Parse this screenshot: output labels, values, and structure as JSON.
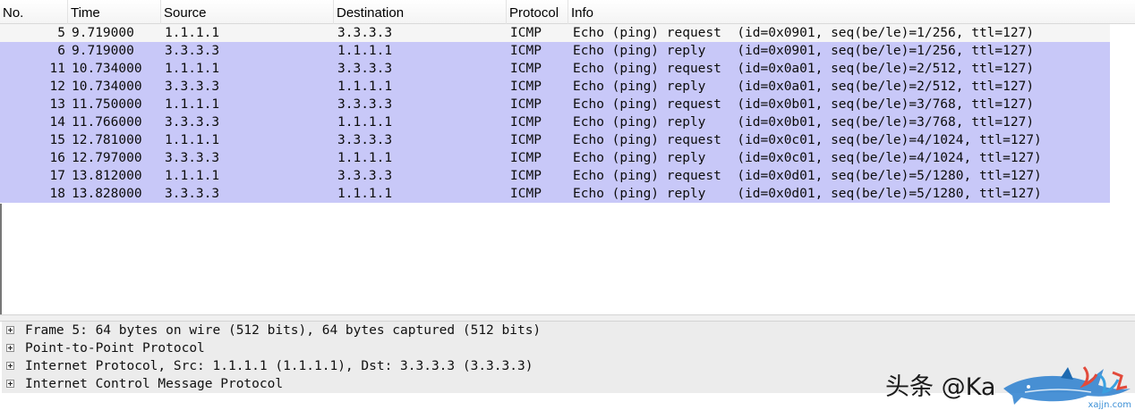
{
  "columns": {
    "no": "No.",
    "time": "Time",
    "source": "Source",
    "destination": "Destination",
    "protocol": "Protocol",
    "info": "Info"
  },
  "packets": [
    {
      "no": "5",
      "time": "9.719000",
      "source": "1.1.1.1",
      "destination": "3.3.3.3",
      "protocol": "ICMP",
      "info": "Echo (ping) request  (id=0x0901, seq(be/le)=1/256, ttl=127)",
      "selected": true
    },
    {
      "no": "6",
      "time": "9.719000",
      "source": "3.3.3.3",
      "destination": "1.1.1.1",
      "protocol": "ICMP",
      "info": "Echo (ping) reply    (id=0x0901, seq(be/le)=1/256, ttl=127)"
    },
    {
      "no": "11",
      "time": "10.734000",
      "source": "1.1.1.1",
      "destination": "3.3.3.3",
      "protocol": "ICMP",
      "info": "Echo (ping) request  (id=0x0a01, seq(be/le)=2/512, ttl=127)"
    },
    {
      "no": "12",
      "time": "10.734000",
      "source": "3.3.3.3",
      "destination": "1.1.1.1",
      "protocol": "ICMP",
      "info": "Echo (ping) reply    (id=0x0a01, seq(be/le)=2/512, ttl=127)"
    },
    {
      "no": "13",
      "time": "11.750000",
      "source": "1.1.1.1",
      "destination": "3.3.3.3",
      "protocol": "ICMP",
      "info": "Echo (ping) request  (id=0x0b01, seq(be/le)=3/768, ttl=127)"
    },
    {
      "no": "14",
      "time": "11.766000",
      "source": "3.3.3.3",
      "destination": "1.1.1.1",
      "protocol": "ICMP",
      "info": "Echo (ping) reply    (id=0x0b01, seq(be/le)=3/768, ttl=127)"
    },
    {
      "no": "15",
      "time": "12.781000",
      "source": "1.1.1.1",
      "destination": "3.3.3.3",
      "protocol": "ICMP",
      "info": "Echo (ping) request  (id=0x0c01, seq(be/le)=4/1024, ttl=127)"
    },
    {
      "no": "16",
      "time": "12.797000",
      "source": "3.3.3.3",
      "destination": "1.1.1.1",
      "protocol": "ICMP",
      "info": "Echo (ping) reply    (id=0x0c01, seq(be/le)=4/1024, ttl=127)"
    },
    {
      "no": "17",
      "time": "13.812000",
      "source": "1.1.1.1",
      "destination": "3.3.3.3",
      "protocol": "ICMP",
      "info": "Echo (ping) request  (id=0x0d01, seq(be/le)=5/1280, ttl=127)"
    },
    {
      "no": "18",
      "time": "13.828000",
      "source": "3.3.3.3",
      "destination": "1.1.1.1",
      "protocol": "ICMP",
      "info": "Echo (ping) reply    (id=0x0d01, seq(be/le)=5/1280, ttl=127)"
    }
  ],
  "details": [
    {
      "label": "Frame 5: 64 bytes on wire (512 bits), 64 bytes captured (512 bits)",
      "icon": "expand-plus-icon"
    },
    {
      "label": "Point-to-Point Protocol",
      "icon": "expand-plus-icon"
    },
    {
      "label": "Internet Protocol, Src: 1.1.1.1 (1.1.1.1), Dst: 3.3.3.3 (3.3.3.3)",
      "icon": "expand-plus-icon"
    },
    {
      "label": "Internet Control Message Protocol",
      "icon": "expand-plus-icon"
    }
  ],
  "watermark": {
    "text": "头条 @Ka",
    "logo_text": "",
    "url": "xajjn.com",
    "icon": "shark-logo-icon"
  },
  "colors": {
    "icmp_row": "#c8c8f8",
    "selected_row": "#f5f5f5",
    "detail_row": "#ececec"
  }
}
